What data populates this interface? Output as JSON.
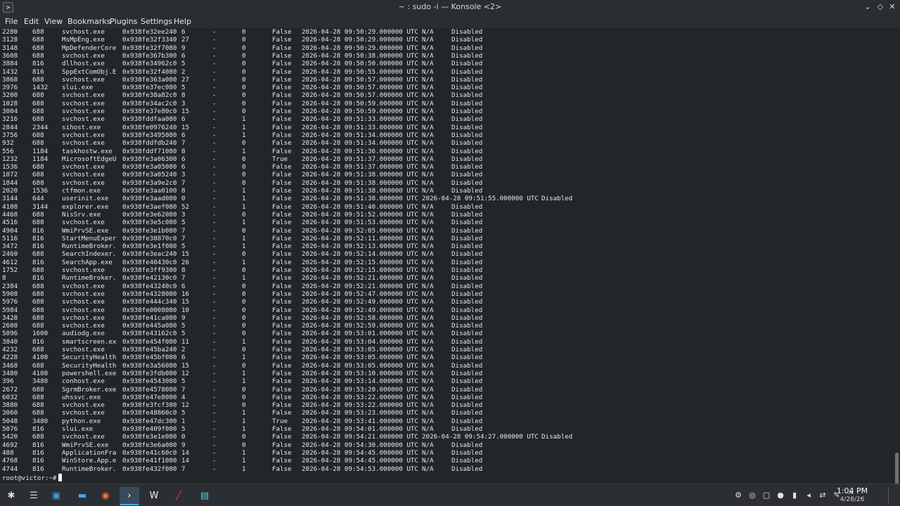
{
  "window": {
    "title": "~ : sudo -i — Konsole <2>"
  },
  "menu": [
    "File",
    "Edit",
    "View",
    "Bookmarks",
    "Plugins",
    "Settings",
    "Help"
  ],
  "rows": [
    [
      "2280",
      "688",
      "svchost.exe",
      "0x938fe32ee240",
      "6",
      "-",
      "0",
      "False",
      "2026-04-28 09:50:29.000000 UTC",
      "N/A",
      "Disabled"
    ],
    [
      "3128",
      "688",
      "MsMpEng.exe",
      "0x938fe32f3340",
      "27",
      "-",
      "0",
      "False",
      "2026-04-28 09:50:29.000000 UTC",
      "N/A",
      "Disabled"
    ],
    [
      "3148",
      "688",
      "MpDefenderCore",
      "0x938fe32f7080",
      "9",
      "-",
      "0",
      "False",
      "2026-04-28 09:50:29.000000 UTC",
      "N/A",
      "Disabled"
    ],
    [
      "3608",
      "688",
      "svchost.exe",
      "0x938fe367b300",
      "6",
      "-",
      "0",
      "False",
      "2026-04-28 09:50:38.000000 UTC",
      "N/A",
      "Disabled"
    ],
    [
      "3884",
      "816",
      "dllhost.exe",
      "0x938fe34962c0",
      "5",
      "-",
      "0",
      "False",
      "2026-04-28 09:50:50.000000 UTC",
      "N/A",
      "Disabled"
    ],
    [
      "1432",
      "816",
      "SppExtComObj.E",
      "0x938fe32f4080",
      "2",
      "-",
      "0",
      "False",
      "2026-04-28 09:50:55.000000 UTC",
      "N/A",
      "Disabled"
    ],
    [
      "3868",
      "688",
      "svchost.exe",
      "0x938fe363a080",
      "27",
      "-",
      "0",
      "False",
      "2026-04-28 09:50:57.000000 UTC",
      "N/A",
      "Disabled"
    ],
    [
      "3976",
      "1432",
      "slui.exe",
      "0x938fe37ec080",
      "5",
      "-",
      "0",
      "False",
      "2026-04-28 09:50:57.000000 UTC",
      "N/A",
      "Disabled"
    ],
    [
      "3200",
      "688",
      "svchost.exe",
      "0x938fe38a82c0",
      "8",
      "-",
      "0",
      "False",
      "2026-04-28 09:50:57.000000 UTC",
      "N/A",
      "Disabled"
    ],
    [
      "1028",
      "688",
      "svchost.exe",
      "0x938fe34ac2c0",
      "3",
      "-",
      "0",
      "False",
      "2026-04-28 09:50:59.000000 UTC",
      "N/A",
      "Disabled"
    ],
    [
      "3004",
      "688",
      "svchost.exe",
      "0x938fe37e80c0",
      "15",
      "-",
      "0",
      "False",
      "2026-04-28 09:50:59.000000 UTC",
      "N/A",
      "Disabled"
    ],
    [
      "3216",
      "688",
      "svchost.exe",
      "0x938fddfaa080",
      "6",
      "-",
      "1",
      "False",
      "2026-04-28 09:51:33.000000 UTC",
      "N/A",
      "Disabled"
    ],
    [
      "2844",
      "2344",
      "sihost.exe",
      "0x938fe0976240",
      "15",
      "-",
      "1",
      "False",
      "2026-04-28 09:51:33.000000 UTC",
      "N/A",
      "Disabled"
    ],
    [
      "3756",
      "688",
      "svchost.exe",
      "0x938fe3495080",
      "6",
      "-",
      "1",
      "False",
      "2026-04-28 09:51:34.000000 UTC",
      "N/A",
      "Disabled"
    ],
    [
      "932",
      "688",
      "svchost.exe",
      "0x938fddfdb240",
      "7",
      "-",
      "0",
      "False",
      "2026-04-28 09:51:34.000000 UTC",
      "N/A",
      "Disabled"
    ],
    [
      "556",
      "1184",
      "taskhostw.exe",
      "0x938fddf71080",
      "8",
      "-",
      "1",
      "False",
      "2026-04-28 09:51:36.000000 UTC",
      "N/A",
      "Disabled"
    ],
    [
      "1232",
      "1184",
      "MicrosoftEdgeU",
      "0x938fe3a06300",
      "6",
      "-",
      "0",
      "True",
      "2026-04-28 09:51:37.000000 UTC",
      "N/A",
      "Disabled"
    ],
    [
      "1536",
      "688",
      "svchost.exe",
      "0x938fe3a05080",
      "6",
      "-",
      "0",
      "False",
      "2026-04-28 09:51:37.000000 UTC",
      "N/A",
      "Disabled"
    ],
    [
      "1072",
      "688",
      "svchost.exe",
      "0x938fe3a05240",
      "3",
      "-",
      "0",
      "False",
      "2026-04-28 09:51:38.000000 UTC",
      "N/A",
      "Disabled"
    ],
    [
      "1844",
      "688",
      "svchost.exe",
      "0x938fe3a9e2c0",
      "7",
      "-",
      "0",
      "False",
      "2026-04-28 09:51:38.000000 UTC",
      "N/A",
      "Disabled"
    ],
    [
      "2020",
      "1536",
      "ctfmon.exe",
      "0x938fe3aa0100",
      "8",
      "-",
      "1",
      "False",
      "2026-04-28 09:51:38.000000 UTC",
      "N/A",
      "Disabled"
    ],
    [
      "3144",
      "644",
      "userinit.exe",
      "0x938fe3aad080",
      "0",
      "-",
      "1",
      "False",
      "2026-04-28 09:51:38.000000 UTC",
      "2026-04-28 09:51:55.000000 UTC",
      "Disabled"
    ],
    [
      "4108",
      "3144",
      "explorer.exe",
      "0x938fe3aef080",
      "52",
      "-",
      "1",
      "False",
      "2026-04-28 09:51:40.000000 UTC",
      "N/A",
      "Disabled"
    ],
    [
      "4468",
      "688",
      "NisSrv.exe",
      "0x938fe3e62080",
      "3",
      "-",
      "0",
      "False",
      "2026-04-28 09:51:52.000000 UTC",
      "N/A",
      "Disabled"
    ],
    [
      "4516",
      "688",
      "svchost.exe",
      "0x938fe3e5c080",
      "5",
      "-",
      "1",
      "False",
      "2026-04-28 09:51:53.000000 UTC",
      "N/A",
      "Disabled"
    ],
    [
      "4904",
      "816",
      "WmiPrvSE.exe",
      "0x938fe3e1b080",
      "7",
      "-",
      "0",
      "False",
      "2026-04-28 09:52:05.000000 UTC",
      "N/A",
      "Disabled"
    ],
    [
      "5116",
      "816",
      "StartMenuExper",
      "0x938fe38870c0",
      "7",
      "-",
      "1",
      "False",
      "2026-04-28 09:52:11.000000 UTC",
      "N/A",
      "Disabled"
    ],
    [
      "3472",
      "816",
      "RuntimeBroker.",
      "0x938fe3e1f080",
      "5",
      "-",
      "1",
      "False",
      "2026-04-28 09:52:13.000000 UTC",
      "N/A",
      "Disabled"
    ],
    [
      "2460",
      "688",
      "SearchIndexer.",
      "0x938fe3eac240",
      "15",
      "-",
      "0",
      "False",
      "2026-04-28 09:52:14.000000 UTC",
      "N/A",
      "Disabled"
    ],
    [
      "4612",
      "816",
      "SearchApp.exe",
      "0x938fe40430c0",
      "26",
      "-",
      "1",
      "False",
      "2026-04-28 09:52:15.000000 UTC",
      "N/A",
      "Disabled"
    ],
    [
      "1752",
      "688",
      "svchost.exe",
      "0x938fe3ff9300",
      "8",
      "-",
      "0",
      "False",
      "2026-04-28 09:52:15.000000 UTC",
      "N/A",
      "Disabled"
    ],
    [
      "8",
      "816",
      "RuntimeBroker.",
      "0x938fe42130c0",
      "7",
      "-",
      "1",
      "False",
      "2026-04-28 09:52:21.000000 UTC",
      "N/A",
      "Disabled"
    ],
    [
      "2384",
      "688",
      "svchost.exe",
      "0x938fe43240c0",
      "6",
      "-",
      "0",
      "False",
      "2026-04-28 09:52:21.000000 UTC",
      "N/A",
      "Disabled"
    ],
    [
      "5908",
      "688",
      "svchost.exe",
      "0x938fe4328080",
      "16",
      "-",
      "0",
      "False",
      "2026-04-28 09:52:47.000000 UTC",
      "N/A",
      "Disabled"
    ],
    [
      "5976",
      "688",
      "svchost.exe",
      "0x938fe444c340",
      "15",
      "-",
      "0",
      "False",
      "2026-04-28 09:52:49.000000 UTC",
      "N/A",
      "Disabled"
    ],
    [
      "5984",
      "688",
      "svchost.exe",
      "0x938fe0008080",
      "10",
      "-",
      "0",
      "False",
      "2026-04-28 09:52:49.000000 UTC",
      "N/A",
      "Disabled"
    ],
    [
      "3428",
      "688",
      "svchost.exe",
      "0x938fe41ca080",
      "9",
      "-",
      "0",
      "False",
      "2026-04-28 09:52:58.000000 UTC",
      "N/A",
      "Disabled"
    ],
    [
      "2608",
      "688",
      "svchost.exe",
      "0x938fe445a080",
      "5",
      "-",
      "0",
      "False",
      "2026-04-28 09:52:59.000000 UTC",
      "N/A",
      "Disabled"
    ],
    [
      "5096",
      "1600",
      "audiodg.exe",
      "0x938fe43162c0",
      "5",
      "-",
      "0",
      "False",
      "2026-04-28 09:53:01.000000 UTC",
      "N/A",
      "Disabled"
    ],
    [
      "3840",
      "816",
      "smartscreen.ex",
      "0x938fe454f080",
      "11",
      "-",
      "1",
      "False",
      "2026-04-28 09:53:04.000000 UTC",
      "N/A",
      "Disabled"
    ],
    [
      "4232",
      "688",
      "svchost.exe",
      "0x938fe45ba240",
      "2",
      "-",
      "0",
      "False",
      "2026-04-28 09:53:05.000000 UTC",
      "N/A",
      "Disabled"
    ],
    [
      "4228",
      "4108",
      "SecurityHealth",
      "0x938fe45bf080",
      "6",
      "-",
      "1",
      "False",
      "2026-04-28 09:53:05.000000 UTC",
      "N/A",
      "Disabled"
    ],
    [
      "3468",
      "688",
      "SecurityHealth",
      "0x938fe3a56080",
      "15",
      "-",
      "0",
      "False",
      "2026-04-28 09:53:05.000000 UTC",
      "N/A",
      "Disabled"
    ],
    [
      "3480",
      "4108",
      "powershell.exe",
      "0x938fe3fdb080",
      "12",
      "-",
      "1",
      "False",
      "2026-04-28 09:53:10.000000 UTC",
      "N/A",
      "Disabled"
    ],
    [
      "396",
      "3480",
      "conhost.exe",
      "0x938fe4543080",
      "5",
      "-",
      "1",
      "False",
      "2026-04-28 09:53:14.000000 UTC",
      "N/A",
      "Disabled"
    ],
    [
      "2672",
      "688",
      "SgrmBroker.exe",
      "0x938fe4578080",
      "7",
      "-",
      "0",
      "False",
      "2026-04-28 09:53:20.000000 UTC",
      "N/A",
      "Disabled"
    ],
    [
      "6032",
      "688",
      "uhssvc.exe",
      "0x938fe47e8080",
      "4",
      "-",
      "0",
      "False",
      "2026-04-28 09:53:22.000000 UTC",
      "N/A",
      "Disabled"
    ],
    [
      "3880",
      "688",
      "svchost.exe",
      "0x938fe3fcf300",
      "12",
      "-",
      "0",
      "False",
      "2026-04-28 09:53:22.000000 UTC",
      "N/A",
      "Disabled"
    ],
    [
      "3060",
      "688",
      "svchost.exe",
      "0x938fe48860c0",
      "5",
      "-",
      "1",
      "False",
      "2026-04-28 09:53:23.000000 UTC",
      "N/A",
      "Disabled"
    ],
    [
      "5048",
      "3480",
      "python.exe",
      "0x938fe47dc300",
      "1",
      "-",
      "1",
      "True",
      "2026-04-28 09:53:41.000000 UTC",
      "N/A",
      "Disabled"
    ],
    [
      "5076",
      "816",
      "slui.exe",
      "0x938fe409f080",
      "5",
      "-",
      "1",
      "False",
      "2026-04-28 09:54:01.000000 UTC",
      "N/A",
      "Disabled"
    ],
    [
      "5420",
      "688",
      "svchost.exe",
      "0x938fe3e1e080",
      "0",
      "-",
      "0",
      "False",
      "2026-04-28 09:54:21.000000 UTC",
      "2026-04-28 09:54:27.000000 UTC",
      "Disabled"
    ],
    [
      "4692",
      "816",
      "WmiPrvSE.exe",
      "0x938fe3e6a080",
      "9",
      "-",
      "0",
      "False",
      "2026-04-28 09:54:30.000000 UTC",
      "N/A",
      "Disabled"
    ],
    [
      "488",
      "816",
      "ApplicationFra",
      "0x938fe41c60c0",
      "14",
      "-",
      "1",
      "False",
      "2026-04-28 09:54:45.000000 UTC",
      "N/A",
      "Disabled"
    ],
    [
      "4768",
      "816",
      "WinStore.App.e",
      "0x938fe41f1080",
      "14",
      "-",
      "1",
      "False",
      "2026-04-28 09:54:45.000000 UTC",
      "N/A",
      "Disabled"
    ],
    [
      "4744",
      "816",
      "RuntimeBroker.",
      "0x938fe432f080",
      "7",
      "-",
      "1",
      "False",
      "2026-04-28 09:54:53.000000 UTC",
      "N/A",
      "Disabled"
    ]
  ],
  "prompt": "root@victor:~#",
  "clock": {
    "time": "1:04 PM",
    "date": "4/28/26"
  },
  "taskbar": {
    "items": [
      {
        "icon": "✱",
        "name": "app-launcher-icon",
        "color": "#d8d8d8"
      },
      {
        "icon": "☰",
        "name": "task-switcher-icon",
        "color": "#cfd8dc"
      },
      {
        "icon": "▣",
        "name": "store-icon",
        "color": "#2ea7e0"
      },
      {
        "icon": "▬",
        "name": "file-manager-icon",
        "color": "#3daee9"
      },
      {
        "icon": "◉",
        "name": "firefox-icon",
        "color": "#ff7139"
      },
      {
        "icon": "›",
        "name": "konsole-icon",
        "color": "#fcfcfc"
      },
      {
        "icon": "W",
        "name": "wireshark-icon",
        "color": "#f0f0f0"
      },
      {
        "icon": "╱",
        "name": "pen-tool-icon",
        "color": "#e53935"
      },
      {
        "icon": "▤",
        "name": "screen-tool-icon",
        "color": "#4dd0e1"
      }
    ],
    "tray": [
      {
        "icon": "⚙",
        "name": "settings-tray-icon"
      },
      {
        "icon": "◎",
        "name": "network-tray-icon"
      },
      {
        "icon": "▢",
        "name": "clipboard-tray-icon"
      },
      {
        "icon": "●",
        "name": "notifications-tray-icon"
      },
      {
        "icon": "▮",
        "name": "battery-tray-icon"
      },
      {
        "icon": "◂",
        "name": "volume-tray-icon"
      },
      {
        "icon": "⇄",
        "name": "connections-tray-icon"
      },
      {
        "icon": "✎",
        "name": "edit-tray-icon"
      },
      {
        "icon": "^",
        "name": "tray-expand-icon"
      }
    ]
  }
}
